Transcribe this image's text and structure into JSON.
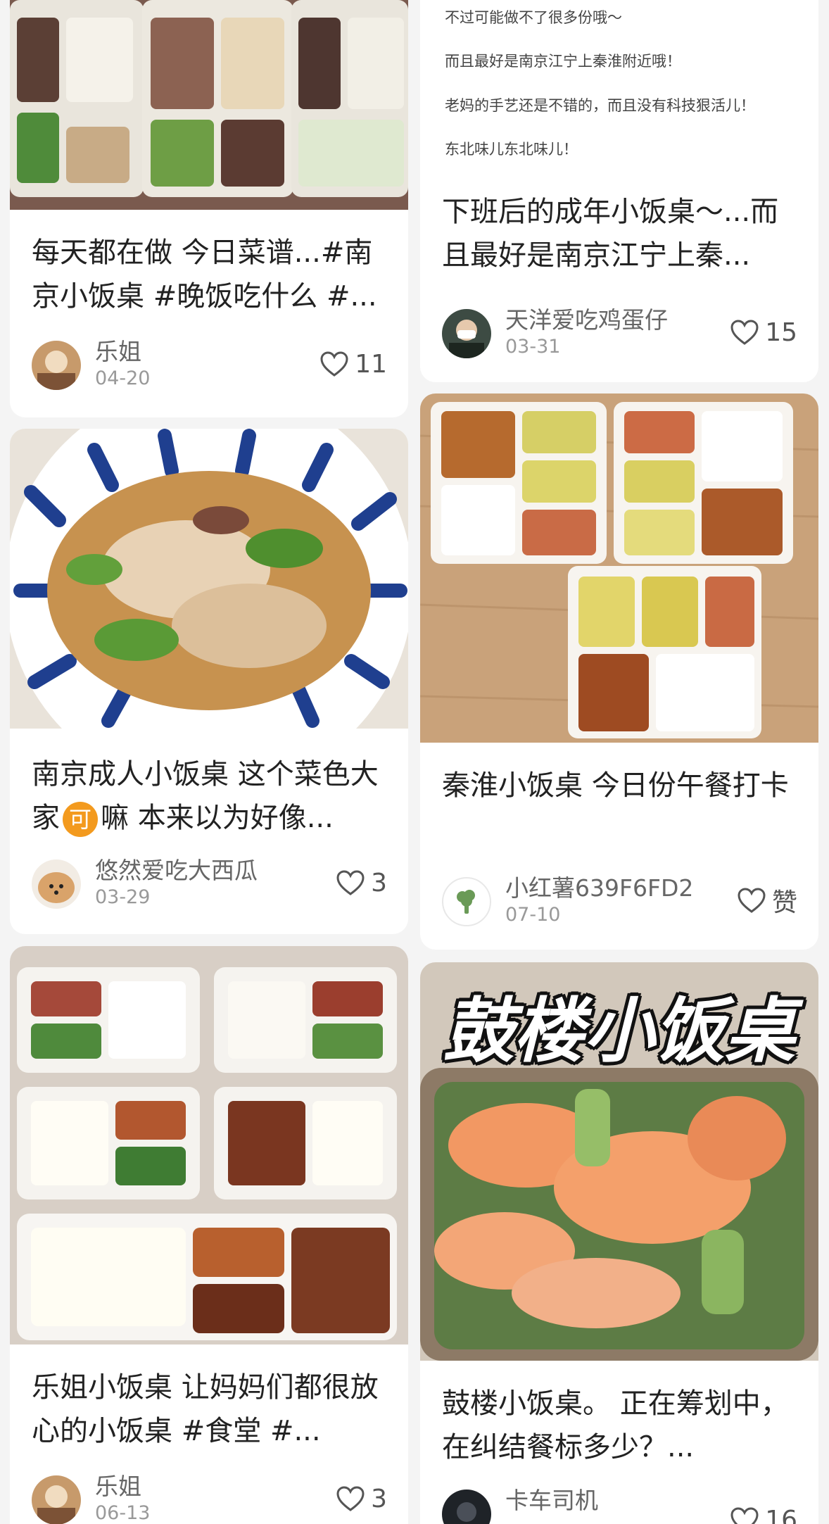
{
  "feed": {
    "cards": [
      {
        "title": "每天都在做 今日菜谱...#南京小饭桌 #晚饭吃什么 #...",
        "author": "乐姐",
        "date": "04-20",
        "likes": "11"
      },
      {
        "note_lines": [
          "不过可能做不了很多份哦～",
          "而且最好是南京江宁上秦淮附近哦！",
          "老妈的手艺还是不错的，而且没有科技狠活儿！",
          "东北味儿东北味儿！"
        ],
        "title": "下班后的成年小饭桌～...而且最好是南京江宁上秦...",
        "author": "天洋爱吃鸡蛋仔",
        "date": "03-31",
        "likes": "15"
      },
      {
        "title_part1": "南京成人小饭桌 这个菜色大家",
        "title_emoji": "可",
        "title_part2": "嘛 本来以为好像...",
        "author": "悠然爱吃大西瓜",
        "date": "03-29",
        "likes": "3"
      },
      {
        "title": "秦淮小饭桌 今日份午餐打卡",
        "author": "小红薯639F6FD2",
        "date": "07-10",
        "likes": "赞"
      },
      {
        "title": "乐姐小饭桌 让妈妈们都很放心的小饭桌 #食堂 #...",
        "author": "乐姐",
        "date": "06-13",
        "likes": "3"
      },
      {
        "image_caption": "鼓楼小饭桌",
        "title": "鼓楼小饭桌。 正在筹划中，在纠结餐标多少？...",
        "author": "卡车司机",
        "likes": "16"
      }
    ]
  },
  "colors": {
    "background": "#f4f4f4",
    "card": "#ffffff",
    "title": "#222222",
    "author": "#666666",
    "date": "#999999",
    "accent_orange": "#f39a1e"
  },
  "icons": {
    "like": "heart-outline-icon",
    "avatar_placeholder": "broccoli-icon"
  }
}
